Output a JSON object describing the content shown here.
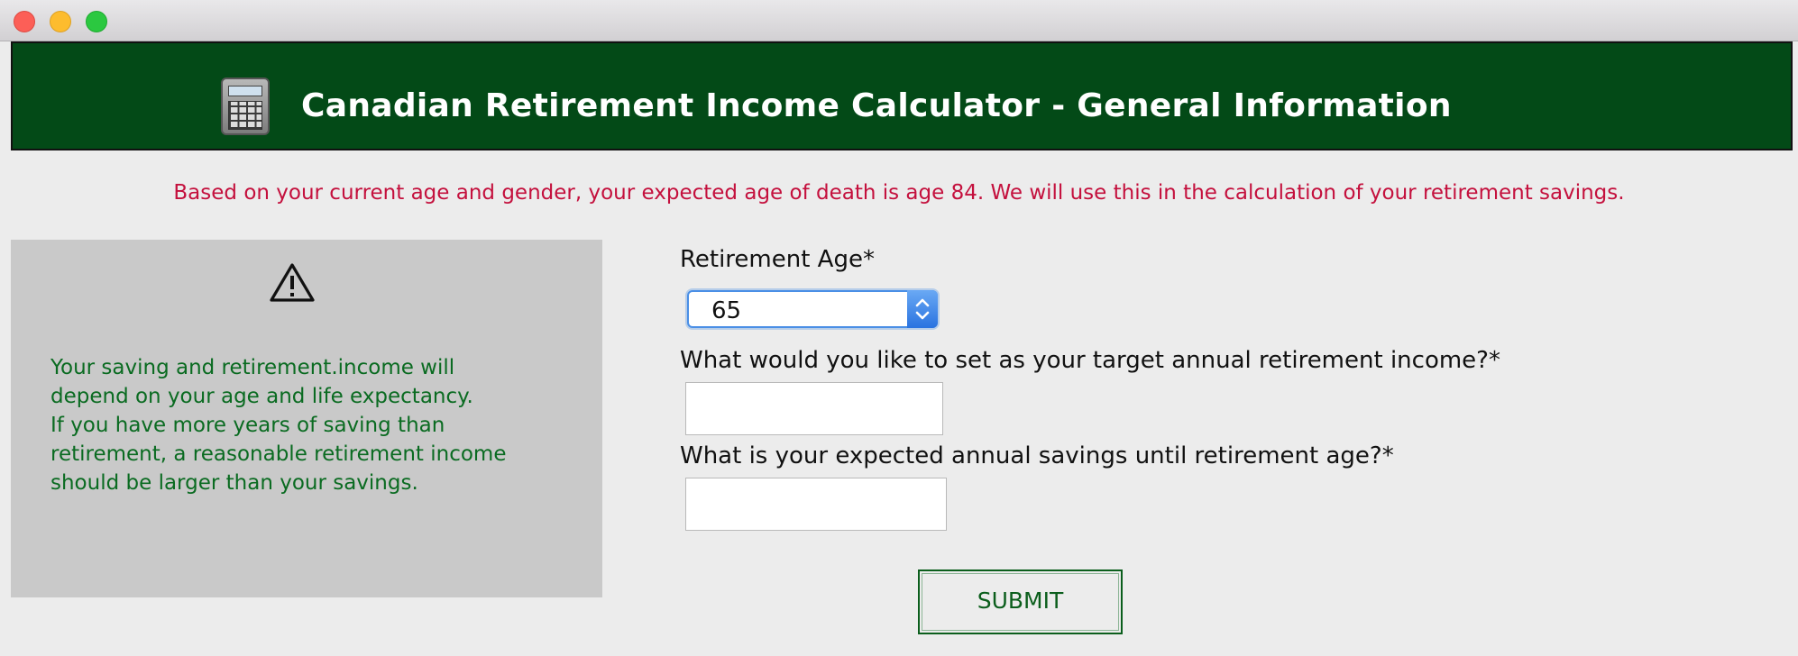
{
  "header": {
    "title": "Canadian Retirement Income Calculator - General Information",
    "icon": "calculator-icon"
  },
  "notice": "Based on your current age and gender, your expected age of death is age 84. We will use this in the calculation of your retirement savings.",
  "info_panel": {
    "icon": "warning-icon",
    "lines": [
      "Your saving and retirement.income will",
      "depend on your age and life expectancy.",
      "If you have more years of saving than",
      "retirement, a reasonable retirement income",
      "should be larger than your savings."
    ]
  },
  "form": {
    "retirement_age": {
      "label": "Retirement Age*",
      "value": "65"
    },
    "target_income": {
      "label": "What would you like to set as your target annual retirement income?*",
      "value": ""
    },
    "annual_savings": {
      "label": "What is your expected annual savings until retirement age?*",
      "value": ""
    }
  },
  "submit_label": "SUBMIT",
  "colors": {
    "banner": "#034a17",
    "notice": "#c4103d",
    "info_text": "#0a6b21",
    "panel": "#c9c9c9"
  }
}
